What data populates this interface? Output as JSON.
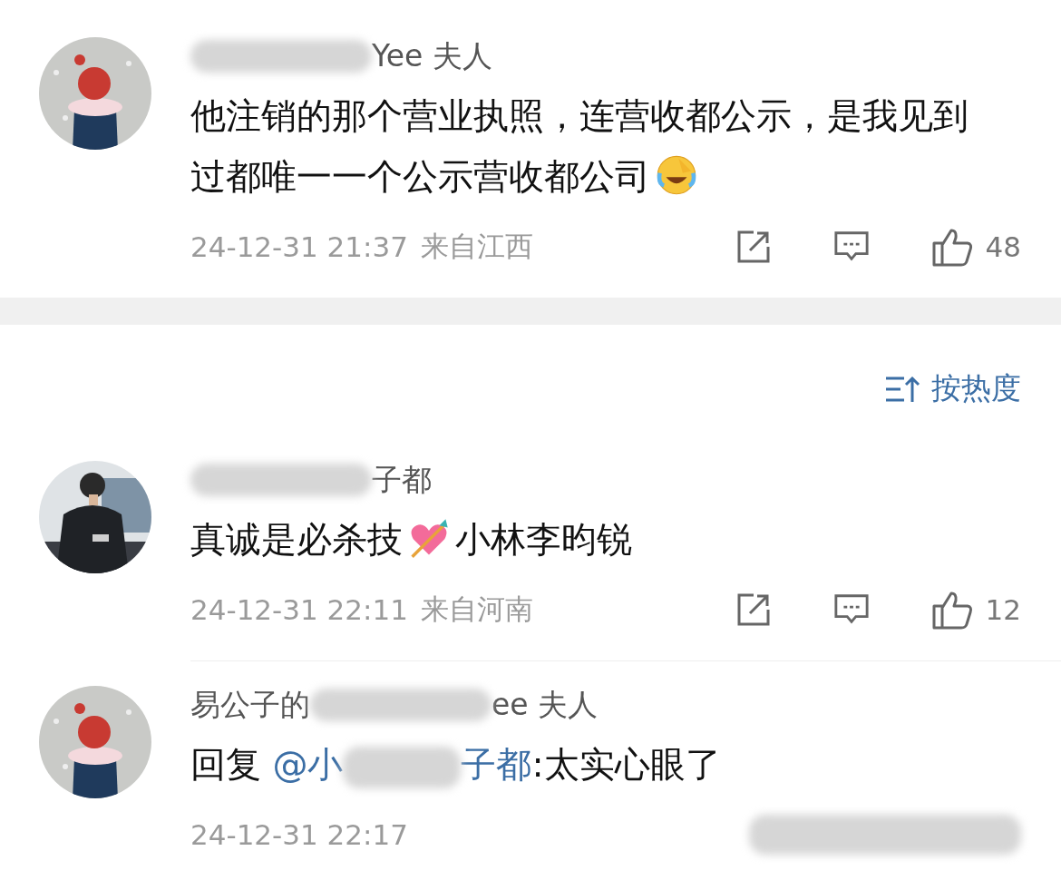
{
  "top_comment": {
    "name_parts": [
      {
        "kind": "blur"
      },
      {
        "kind": "text",
        "text": "Yee 夫人"
      }
    ],
    "content": [
      {
        "kind": "text",
        "text": "他注销的那个营业执照，连营收都公示，是我见到过都唯一一个公示营收都公司"
      },
      {
        "kind": "laugh-emoji"
      }
    ],
    "time": "24-12-31 21:37",
    "location": "来自江西",
    "likes": "48"
  },
  "sort": {
    "label": "按热度"
  },
  "comments": [
    {
      "name_parts": [
        {
          "kind": "blur"
        },
        {
          "kind": "text",
          "text": "子都"
        }
      ],
      "content": [
        {
          "kind": "text",
          "text": "真诚是必杀技"
        },
        {
          "kind": "heart-emoji"
        },
        {
          "kind": "text",
          "text": "小林李昀锐"
        }
      ],
      "time": "24-12-31 22:11",
      "location": "来自河南",
      "likes": "12",
      "actions": true
    },
    {
      "name_parts": [
        {
          "kind": "text",
          "text": "易公子的"
        },
        {
          "kind": "blur"
        },
        {
          "kind": "text",
          "text": "ee 夫人"
        }
      ],
      "content": [
        {
          "kind": "text",
          "text": "回复 "
        },
        {
          "kind": "mention",
          "text": "@小"
        },
        {
          "kind": "blur"
        },
        {
          "kind": "mention",
          "text": "子都"
        },
        {
          "kind": "text",
          "text": ":太实心眼了"
        }
      ],
      "time": "24-12-31 22:17",
      "actions": false
    }
  ]
}
